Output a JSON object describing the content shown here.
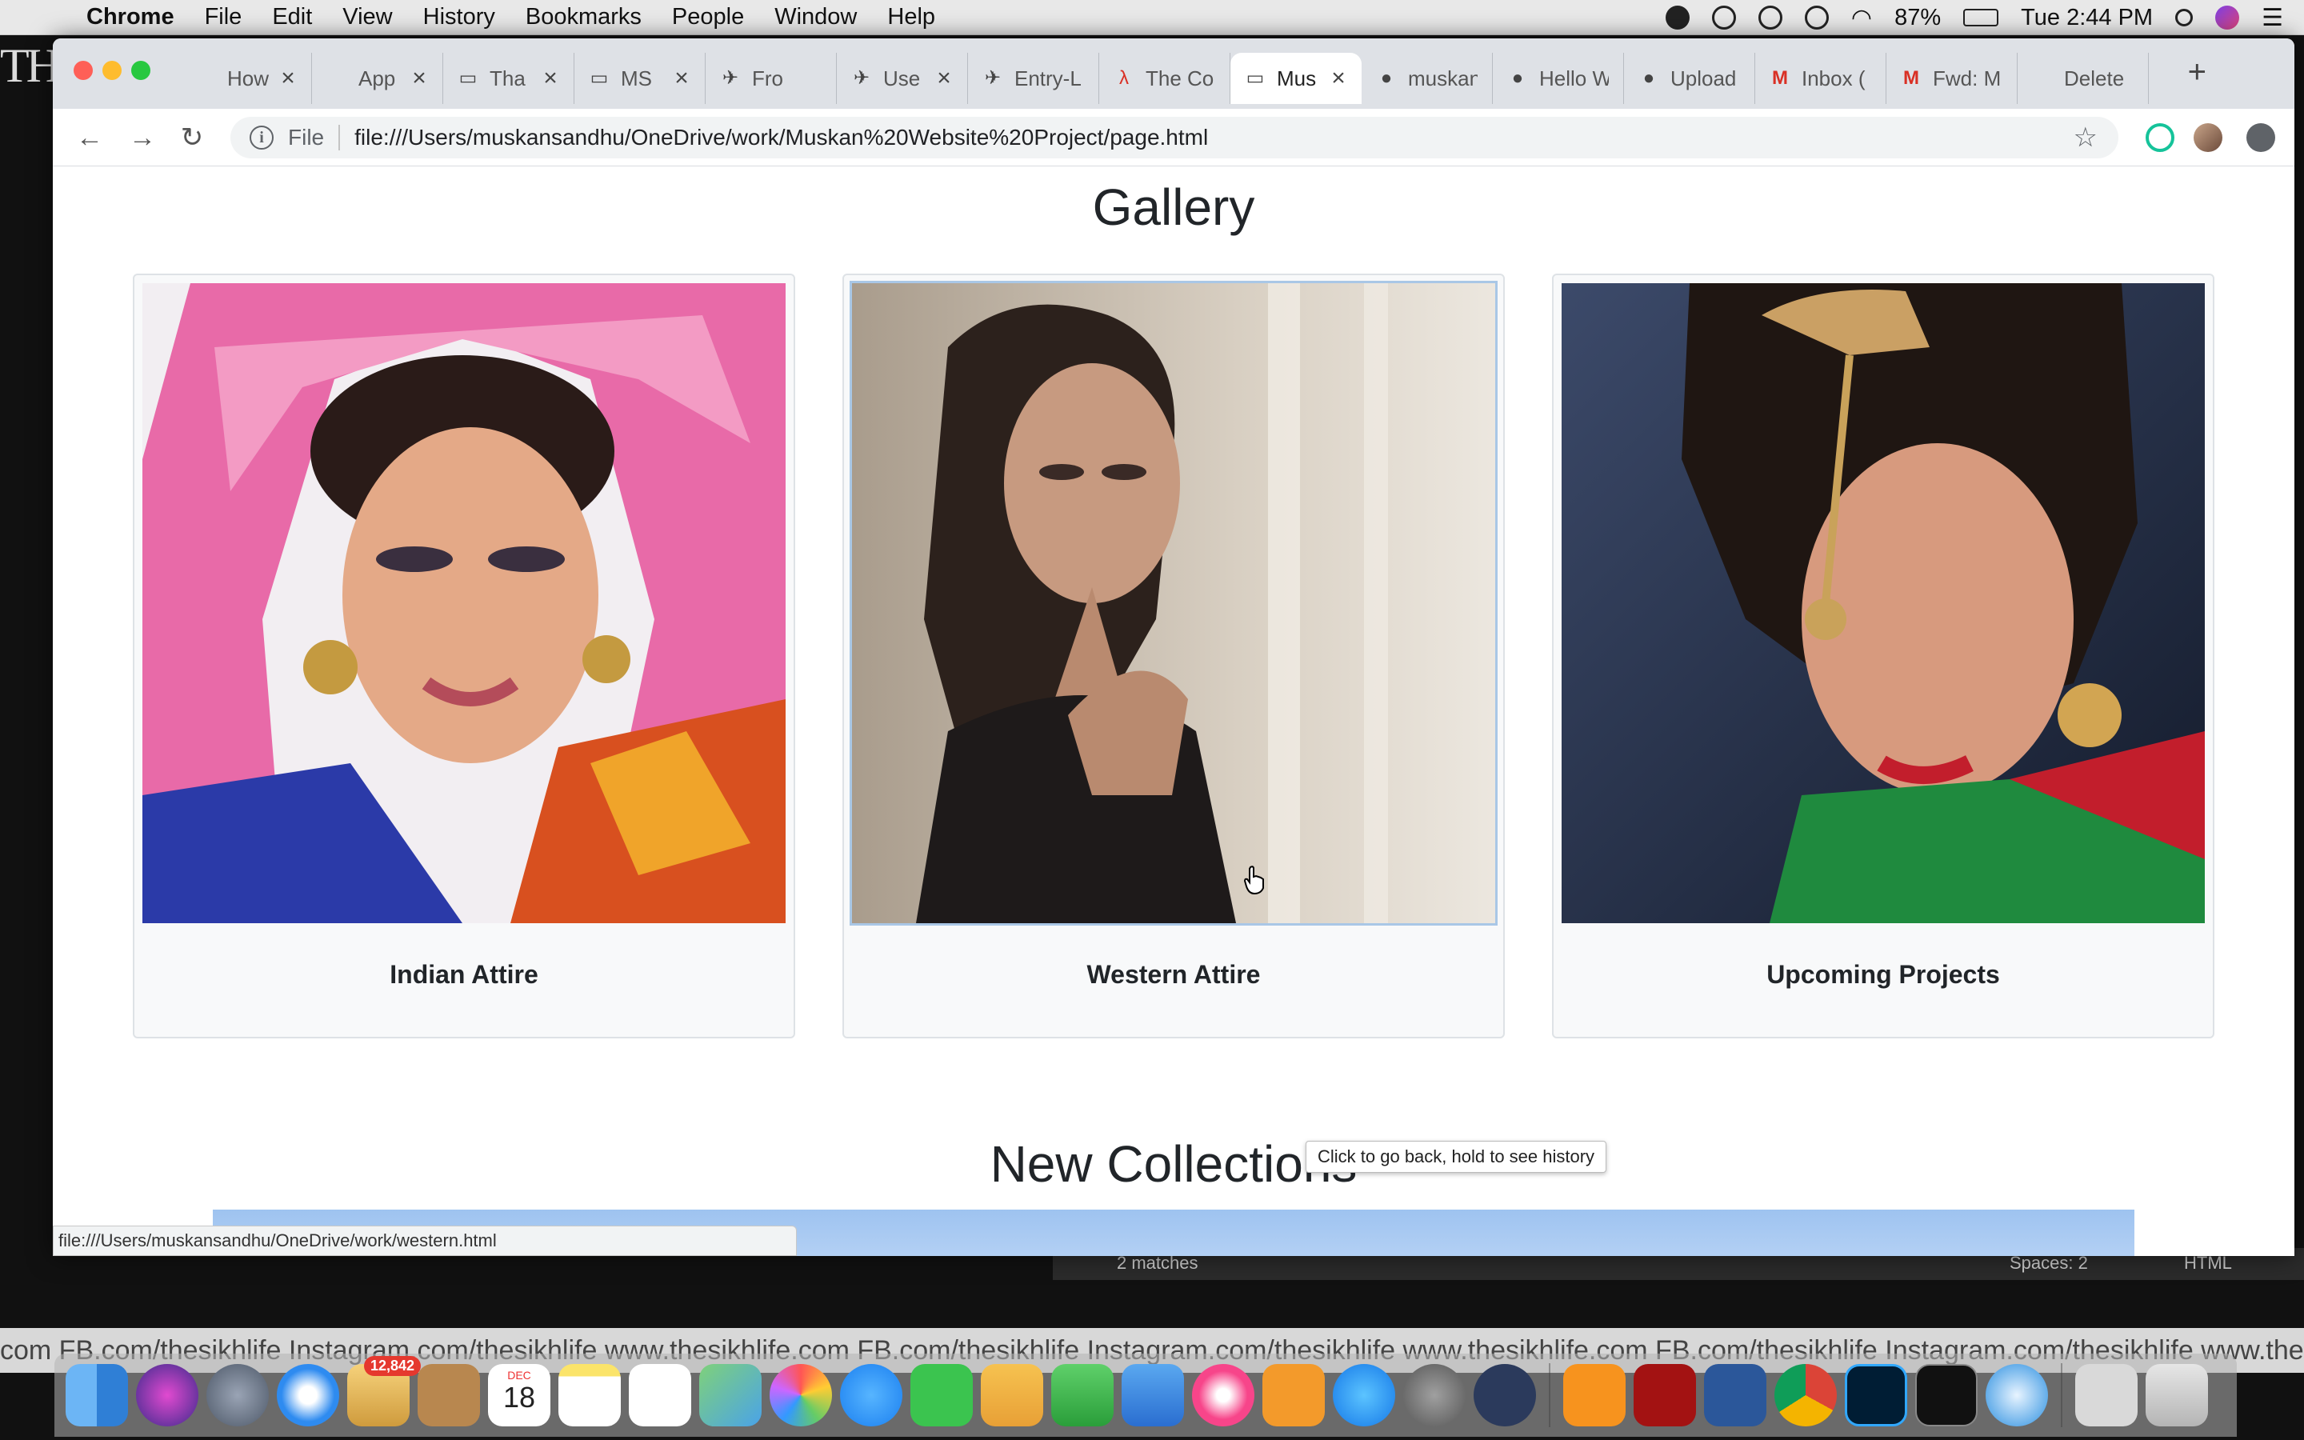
{
  "menubar": {
    "app_name": "Chrome",
    "items": [
      "File",
      "Edit",
      "View",
      "History",
      "Bookmarks",
      "People",
      "Window",
      "Help"
    ],
    "battery": "87%",
    "clock": "Tue 2:44 PM"
  },
  "tabs": [
    {
      "title": "How",
      "icon": "apple-icon"
    },
    {
      "title": "App",
      "icon": "apple-icon"
    },
    {
      "title": "Tha",
      "icon": "page-icon"
    },
    {
      "title": "MS",
      "icon": "page-icon"
    },
    {
      "title": "Fro",
      "icon": "bird-icon"
    },
    {
      "title": "Use",
      "icon": "bird-icon"
    },
    {
      "title": "Entry-L",
      "icon": "bird-icon"
    },
    {
      "title": "The Co",
      "icon": "acrobat-icon"
    },
    {
      "title": "Mus",
      "icon": "page-icon",
      "active": true
    },
    {
      "title": "muskan",
      "icon": "github-icon"
    },
    {
      "title": "Hello W",
      "icon": "github-icon"
    },
    {
      "title": "Upload",
      "icon": "github-icon"
    },
    {
      "title": "Inbox (",
      "icon": "gmail-icon"
    },
    {
      "title": "Fwd: M",
      "icon": "gmail-icon"
    },
    {
      "title": "Delete",
      "icon": "apple-icon"
    }
  ],
  "omnibox": {
    "scheme_label": "File",
    "url": "file:///Users/muskansandhu/OneDrive/work/Muskan%20Website%20Project/page.html"
  },
  "page": {
    "gallery_title": "Gallery",
    "cards": [
      {
        "caption": "Indian Attire"
      },
      {
        "caption": "Western Attire"
      },
      {
        "caption": "Upcoming Projects"
      }
    ],
    "collections_title": "New Collections"
  },
  "tooltip": "Click to go back, hold to see history",
  "status_url": "file:///Users/muskansandhu/OneDrive/work/western.html",
  "background": {
    "editor_matches": "2 matches",
    "editor_spaces": "Spaces: 2",
    "editor_syntax": "HTML",
    "footer_text": "com   FB.com/thesikhlife   Instagram.com/thesikhlife   www.thesikhlife.com   FB.com/thesikhlife   Instagram.com/thesikhlife   www.thesikhlife.com   FB.com/thesikhlife   Instagram.com/thesikhlife   www.thesikhlife.com   FB.com/thesikhlife   Instagram.com/thesikhlife   www.thesikhlife.com"
  },
  "dock": {
    "mail_badge": "12,842",
    "calendar_month": "DEC",
    "calendar_day": "18"
  },
  "colors": {
    "page_text": "#212529",
    "card_border": "#dee2e6",
    "tab_strip": "#dee1e6"
  }
}
